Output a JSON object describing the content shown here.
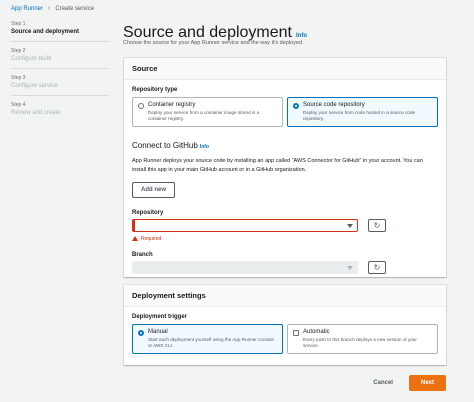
{
  "breadcrumb": {
    "root": "App Runner",
    "current": "Create service"
  },
  "steps": [
    {
      "num": "Step 1",
      "title": "Source and deployment"
    },
    {
      "num": "Step 2",
      "title": "Configure build"
    },
    {
      "num": "Step 3",
      "title": "Configure service"
    },
    {
      "num": "Step 4",
      "title": "Review and create"
    }
  ],
  "header": {
    "title": "Source and deployment",
    "info": "Info",
    "description": "Choose the source for your App Runner service and the way it's deployed."
  },
  "source": {
    "heading": "Source",
    "repo_type_label": "Repository type",
    "options": [
      {
        "title": "Container registry",
        "desc": "Deploy your service from a container image stored in a container registry.",
        "selected": false
      },
      {
        "title": "Source code repository",
        "desc": "Deploy your service from code hosted in a source code repository.",
        "selected": true
      }
    ],
    "connect_title": "Connect to GitHub",
    "connect_info": "Info",
    "connect_desc": "App Runner deploys your source code by installing an app called \"AWS Connector for GitHub\" in your account. You can install this app in your main GitHub account or in a GitHub organization.",
    "add_new": "Add new",
    "repository_label": "Repository",
    "repository_value": "",
    "required_msg": "Required",
    "branch_label": "Branch",
    "branch_value": ""
  },
  "deployment": {
    "heading": "Deployment settings",
    "trigger_label": "Deployment trigger",
    "options": [
      {
        "title": "Manual",
        "desc": "Start each deployment yourself using the App Runner console or AWS CLI.",
        "selected": true
      },
      {
        "title": "Automatic",
        "desc": "Every push to this branch deploys a new version of your service.",
        "selected": false
      }
    ]
  },
  "footer": {
    "cancel": "Cancel",
    "next": "Next"
  },
  "colors": {
    "link": "#0073bb",
    "primary": "#ec7211",
    "error": "#d13212"
  },
  "icons": {
    "refresh": "refresh-icon",
    "warning": "warning-icon",
    "caret": "caret-down-icon"
  }
}
